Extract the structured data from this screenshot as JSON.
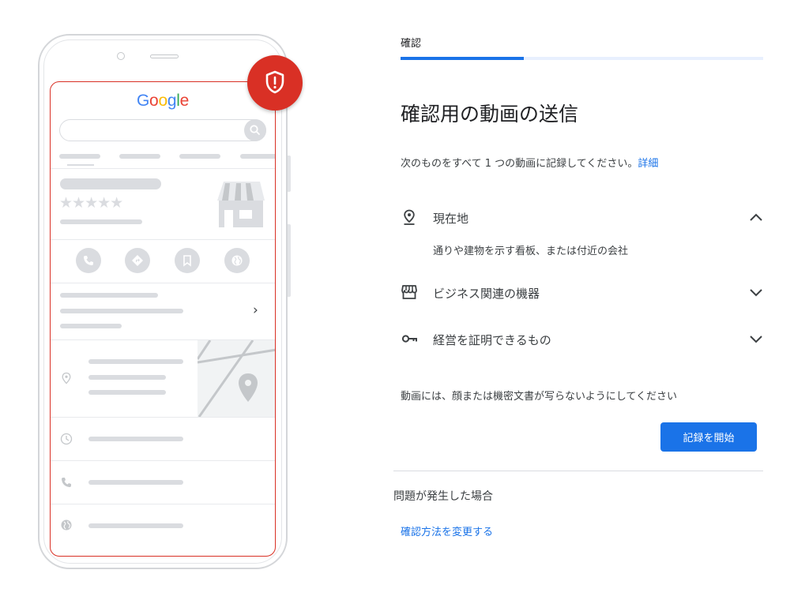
{
  "progress": {
    "step_label": "確認",
    "fraction": 0.34
  },
  "heading": "確認用の動画の送信",
  "intro": {
    "text": "次のものをすべて 1 つの動画に記録してください。",
    "link": "詳細"
  },
  "requirements": [
    {
      "icon": "location-pin-icon",
      "label": "現在地",
      "expanded": true,
      "description": "通りや建物を示す看板、または付近の会社"
    },
    {
      "icon": "storefront-icon",
      "label": "ビジネス関連の機器",
      "expanded": false
    },
    {
      "icon": "key-icon",
      "label": "経営を証明できるもの",
      "expanded": false
    }
  ],
  "note": "動画には、顔または機密文書が写らないようにしてください",
  "primary_button": "記録を開始",
  "trouble_heading": "問題が発生した場合",
  "change_method_link": "確認方法を変更する",
  "illustration": {
    "logo_text": "Google",
    "rating_stars": 5,
    "badge_icon": "shield-alert-icon"
  },
  "colors": {
    "accent": "#1a73e8",
    "alert": "#d93025",
    "placeholder": "#dadce0"
  }
}
